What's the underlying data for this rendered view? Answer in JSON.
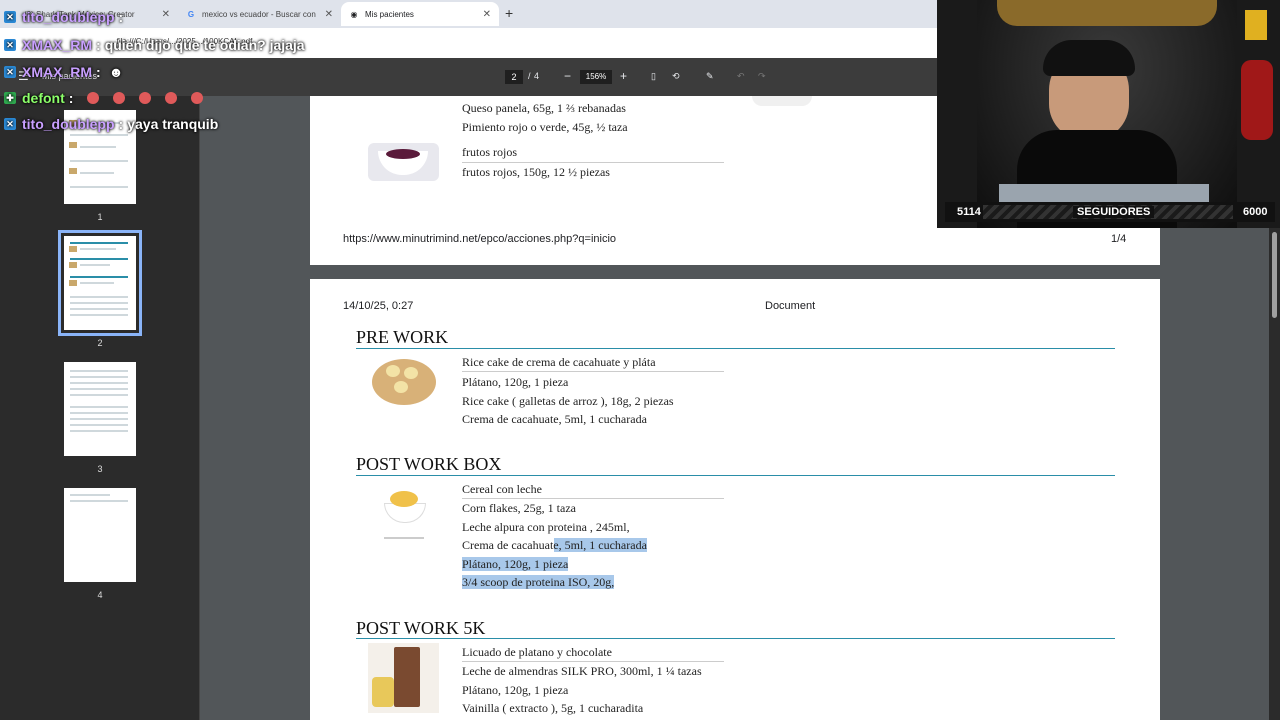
{
  "browser": {
    "tabs": [
      {
        "label": "(8) Shark Tank México: Creator",
        "active": false
      },
      {
        "label": "mexico vs ecuador - Buscar con",
        "active": false
      },
      {
        "label": "Mis pacientes",
        "active": true
      }
    ],
    "address": "...file:///C:/Users/.../2025.../100KCAL.pdf"
  },
  "pdf_toolbar": {
    "doc_title": "Mis pacientes",
    "page_current": "2",
    "page_sep": "/",
    "page_total": "4",
    "zoom": "156%"
  },
  "thumbnails": [
    {
      "num": "1"
    },
    {
      "num": "2"
    },
    {
      "num": "3"
    },
    {
      "num": "4"
    }
  ],
  "page1": {
    "items": [
      "Queso panela, 65g, 1 ⅔ rebanadas",
      "Pimiento rojo o verde, 45g, ½ taza"
    ],
    "frutos_title": "frutos rojos",
    "frutos_item": "frutos rojos, 150g, 12 ½ piezas",
    "footer_url": "https://www.minutrimind.net/epco/acciones.php?q=inicio",
    "footer_page": "1/4"
  },
  "page2": {
    "header_date": "14/10/25, 0:27",
    "header_doc": "Document",
    "sections": [
      {
        "title": "PRE WORK",
        "subtitle": "Rice cake de crema de cacahuate y pláta",
        "items": [
          "Plátano, 120g, 1 pieza",
          "Rice cake ( galletas de arroz ), 18g, 2 piezas",
          "Crema de cacahuate, 5ml, 1 cucharada"
        ]
      },
      {
        "title": "POST WORK BOX",
        "subtitle": "Cereal con leche",
        "items": [
          "Corn flakes, 25g, 1 taza",
          "Leche alpura con proteina , 245ml,",
          "Crema de cacahuate, 5ml, 1 cucharada",
          "Plátano, 120g, 1 pieza",
          "3/4 scoop de proteina ISO, 20g,"
        ]
      },
      {
        "title": "POST WORK 5K",
        "subtitle": "Licuado de platano y chocolate",
        "items": [
          "Leche de almendras SILK PRO, 300ml, 1 ¼ tazas",
          "Plátano, 120g, 1 pieza",
          "Vainilla ( extracto ), 5g, 1 cucharadita"
        ]
      }
    ]
  },
  "chat": [
    {
      "user": "tito_doublepp",
      "sep": ":",
      "msg": ""
    },
    {
      "user": "XMAX_RM",
      "sep": ":",
      "msg": "quien dijo que te odian? jajaja"
    },
    {
      "user": "XMAX_RM",
      "sep": ":",
      "msg": ""
    },
    {
      "user": "defont",
      "sep": ":",
      "msg": ""
    },
    {
      "user": "tito_doublepp",
      "sep": ":",
      "msg": "yaya tranquib"
    }
  ],
  "followers": {
    "current": "5114",
    "label": "SEGUIDORES",
    "goal": "6000"
  },
  "colors": {
    "accent_line": "#2a8ea8",
    "selection": "#a8c8ea",
    "chat_name": "#c9a0ff"
  }
}
